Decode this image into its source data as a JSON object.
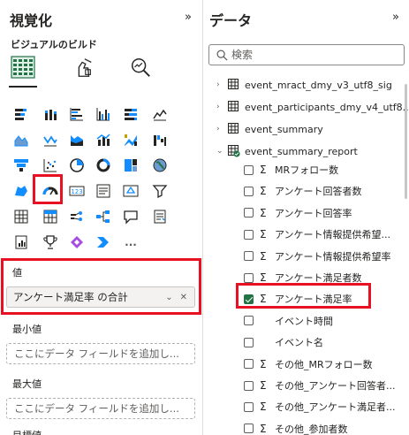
{
  "visualizations": {
    "title": "視覚化",
    "expand_icon": "»",
    "subtitle": "ビジュアルのビルド",
    "modes": [
      "build-visual-icon",
      "format-visual-icon",
      "analytics-icon"
    ],
    "visual_types": [
      "stacked-bar-chart-icon",
      "stacked-column-chart-icon",
      "clustered-bar-chart-icon",
      "clustered-column-chart-icon",
      "100-stacked-bar-chart-icon",
      "line-chart-icon",
      "area-chart-icon",
      "line-stacked-column-icon",
      "stacked-area-chart-icon",
      "line-clustered-column-icon",
      "ribbon-chart-icon",
      "waterfall-chart-icon",
      "funnel-icon",
      "scatter-chart-icon",
      "pie-chart-icon",
      "donut-chart-icon",
      "treemap-icon",
      "map-icon",
      "azure-map-icon",
      "gauge-icon",
      "card-icon",
      "multi-row-card-icon",
      "kpi-icon",
      "slicer-icon",
      "table-icon",
      "matrix-icon",
      "key-influencers-icon",
      "decomposition-tree-icon",
      "qa-icon",
      "smart-narrative-icon",
      "paginated-report-icon",
      "trophy-goals-icon",
      "power-apps-icon",
      "power-automate-icon"
    ],
    "more_label": "...",
    "wells": {
      "value_label": "値",
      "value_field": "アンケート満足率 の合計",
      "min_label": "最小値",
      "min_placeholder": "ここにデータ フィールドを追加し...",
      "max_label": "最大値",
      "max_placeholder": "ここにデータ フィールドを追加し...",
      "target_label": "目標値"
    }
  },
  "data": {
    "title": "データ",
    "expand_icon": "»",
    "search_placeholder": "検索",
    "tables": [
      {
        "name": "event_mract_dmy_v3_utf8_sig",
        "expanded": false
      },
      {
        "name": "event_participants_dmy_v4_utf8...",
        "expanded": false
      },
      {
        "name": "event_summary",
        "expanded": false
      },
      {
        "name": "event_summary_report",
        "expanded": true
      }
    ],
    "fields": [
      {
        "name": "MRフォロー数",
        "sigma": true,
        "checked": false
      },
      {
        "name": "アンケート回答者数",
        "sigma": true,
        "checked": false
      },
      {
        "name": "アンケート回答率",
        "sigma": true,
        "checked": false
      },
      {
        "name": "アンケート情報提供希望...",
        "sigma": true,
        "checked": false
      },
      {
        "name": "アンケート情報提供希望率",
        "sigma": true,
        "checked": false
      },
      {
        "name": "アンケート満足者数",
        "sigma": true,
        "checked": false
      },
      {
        "name": "アンケート満足率",
        "sigma": true,
        "checked": true
      },
      {
        "name": "イベント時間",
        "sigma": false,
        "checked": false
      },
      {
        "name": "イベント名",
        "sigma": false,
        "checked": false
      },
      {
        "name": "その他_MRフォロー数",
        "sigma": true,
        "checked": false
      },
      {
        "name": "その他_アンケート回答者...",
        "sigma": true,
        "checked": false
      },
      {
        "name": "その他_アンケート満足者...",
        "sigma": true,
        "checked": false
      },
      {
        "name": "その他_参加者数",
        "sigma": true,
        "checked": false
      }
    ]
  },
  "colors": {
    "highlight": "#e81123",
    "accent": "#217346",
    "chart_blue": "#118dff"
  }
}
